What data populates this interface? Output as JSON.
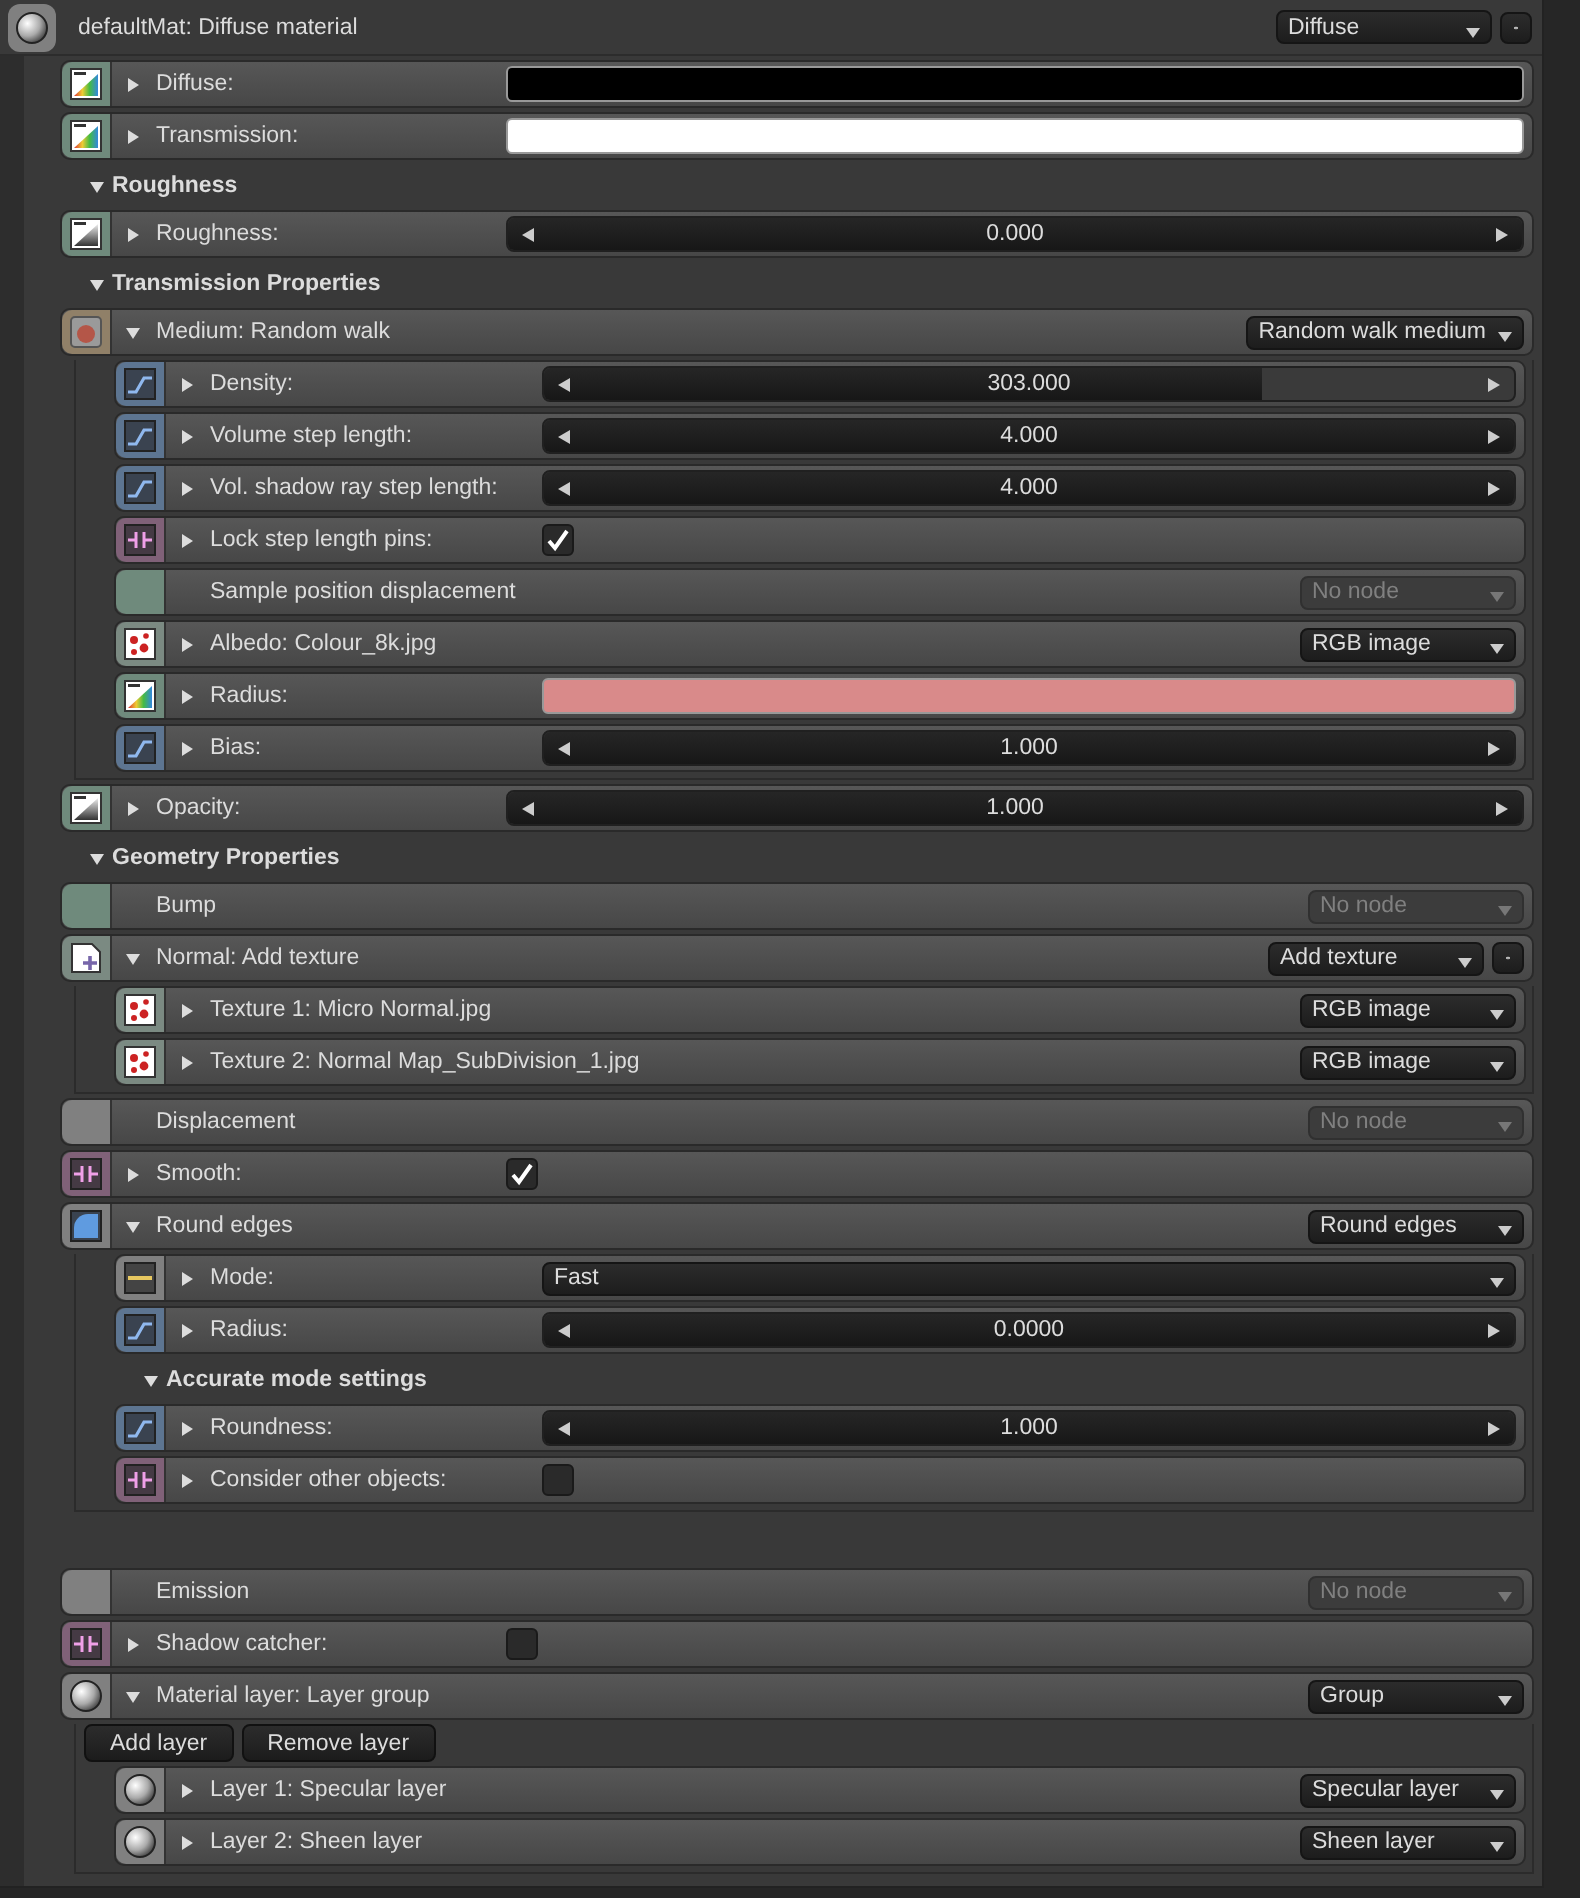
{
  "material": {
    "title": "defaultMat: Diffuse material",
    "pin": {
      "kind": "material"
    },
    "dropdown": {
      "value": "Diffuse",
      "disabled": false
    },
    "eye_button": true
  },
  "items": [
    {
      "kind": "color",
      "pin": {
        "kind": "gradient"
      },
      "label": "Diffuse:",
      "expanded": false,
      "color": "#000000"
    },
    {
      "kind": "color",
      "pin": {
        "kind": "gradient"
      },
      "label": "Transmission:",
      "expanded": false,
      "color": "#ffffff"
    },
    {
      "kind": "section",
      "label": "Roughness",
      "expanded": true
    },
    {
      "kind": "slider",
      "pin": {
        "kind": "greyscale"
      },
      "label": "Roughness:",
      "expanded": false,
      "value": "0.000",
      "level": 1
    },
    {
      "kind": "section",
      "label": "Transmission Properties",
      "expanded": true
    },
    {
      "kind": "node",
      "pin": {
        "kind": "medium"
      },
      "label": "Medium: Random walk",
      "expanded": true,
      "dropdown": {
        "value": "Random walk medium",
        "disabled": false
      },
      "children": [
        {
          "kind": "slider",
          "pin": {
            "kind": "float"
          },
          "label": "Density:",
          "expanded": false,
          "value": "303.000",
          "level": 0.74
        },
        {
          "kind": "slider",
          "pin": {
            "kind": "float"
          },
          "label": "Volume step length:",
          "expanded": false,
          "value": "4.000",
          "level": 1
        },
        {
          "kind": "slider",
          "pin": {
            "kind": "float"
          },
          "label": "Vol. shadow ray step length:",
          "expanded": false,
          "value": "4.000",
          "level": 1
        },
        {
          "kind": "checkbox",
          "pin": {
            "kind": "bool"
          },
          "label": "Lock step length pins:",
          "expanded": false,
          "checked": true
        },
        {
          "kind": "empty",
          "pin": {
            "kind": "texture"
          },
          "label": "Sample position displacement",
          "dropdown": {
            "value": "No node",
            "disabled": true
          }
        },
        {
          "kind": "node",
          "pin": {
            "kind": "image"
          },
          "label": "Albedo: Colour_8k.jpg",
          "expanded": false,
          "dropdown": {
            "value": "RGB image",
            "disabled": false
          }
        },
        {
          "kind": "color",
          "pin": {
            "kind": "gradient"
          },
          "label": "Radius:",
          "expanded": false,
          "color": "#d98a8a"
        },
        {
          "kind": "slider",
          "pin": {
            "kind": "float"
          },
          "label": "Bias:",
          "expanded": false,
          "value": "1.000",
          "level": 1
        }
      ]
    },
    {
      "kind": "slider",
      "pin": {
        "kind": "greyscale"
      },
      "label": "Opacity:",
      "expanded": false,
      "value": "1.000",
      "level": 1
    },
    {
      "kind": "section",
      "label": "Geometry Properties",
      "expanded": true
    },
    {
      "kind": "empty",
      "pin": {
        "kind": "texture"
      },
      "label": "Bump",
      "dropdown": {
        "value": "No node",
        "disabled": true
      }
    },
    {
      "kind": "node",
      "pin": {
        "kind": "normal"
      },
      "label": "Normal: Add texture",
      "expanded": true,
      "dropdown": {
        "value": "Add texture",
        "disabled": false
      },
      "eye_button": true,
      "children": [
        {
          "kind": "node",
          "pin": {
            "kind": "image"
          },
          "label": "Texture 1: Micro Normal.jpg",
          "expanded": false,
          "dropdown": {
            "value": "RGB image",
            "disabled": false
          }
        },
        {
          "kind": "node",
          "pin": {
            "kind": "image"
          },
          "label": "Texture 2: Normal Map_SubDivision_1.jpg",
          "expanded": false,
          "dropdown": {
            "value": "RGB image",
            "disabled": false
          }
        }
      ]
    },
    {
      "kind": "empty",
      "pin": {
        "kind": "plain"
      },
      "label": "Displacement",
      "dropdown": {
        "value": "No node",
        "disabled": true
      }
    },
    {
      "kind": "checkbox",
      "pin": {
        "kind": "bool"
      },
      "label": "Smooth:",
      "expanded": false,
      "checked": true
    },
    {
      "kind": "node",
      "pin": {
        "kind": "round"
      },
      "label": "Round edges",
      "expanded": true,
      "dropdown": {
        "value": "Round edges",
        "disabled": false
      },
      "children": [
        {
          "kind": "enum",
          "pin": {
            "kind": "enum"
          },
          "label": "Mode:",
          "expanded": false,
          "value": "Fast"
        },
        {
          "kind": "slider",
          "pin": {
            "kind": "float"
          },
          "label": "Radius:",
          "expanded": false,
          "value": "0.0000",
          "level": 1
        },
        {
          "kind": "section",
          "label": "Accurate mode settings",
          "expanded": true
        },
        {
          "kind": "slider",
          "pin": {
            "kind": "float"
          },
          "label": "Roundness:",
          "expanded": false,
          "value": "1.000",
          "level": 1
        },
        {
          "kind": "checkbox",
          "pin": {
            "kind": "bool"
          },
          "label": "Consider other objects:",
          "expanded": false,
          "checked": false
        }
      ]
    },
    {
      "kind": "spacer"
    },
    {
      "kind": "empty",
      "pin": {
        "kind": "plain"
      },
      "label": "Emission",
      "dropdown": {
        "value": "No node",
        "disabled": true
      }
    },
    {
      "kind": "checkbox",
      "pin": {
        "kind": "bool"
      },
      "label": "Shadow catcher:",
      "expanded": false,
      "checked": false
    },
    {
      "kind": "node",
      "pin": {
        "kind": "material"
      },
      "label": "Material layer: Layer group",
      "expanded": true,
      "dropdown": {
        "value": "Group",
        "disabled": false
      },
      "buttons": [
        "Add layer",
        "Remove layer"
      ],
      "children": [
        {
          "kind": "node",
          "pin": {
            "kind": "material"
          },
          "label": "Layer 1: Specular layer",
          "expanded": false,
          "dropdown": {
            "value": "Specular layer",
            "disabled": false
          }
        },
        {
          "kind": "node",
          "pin": {
            "kind": "material"
          },
          "label": "Layer 2: Sheen layer",
          "expanded": false,
          "dropdown": {
            "value": "Sheen layer",
            "disabled": false
          }
        }
      ]
    }
  ]
}
